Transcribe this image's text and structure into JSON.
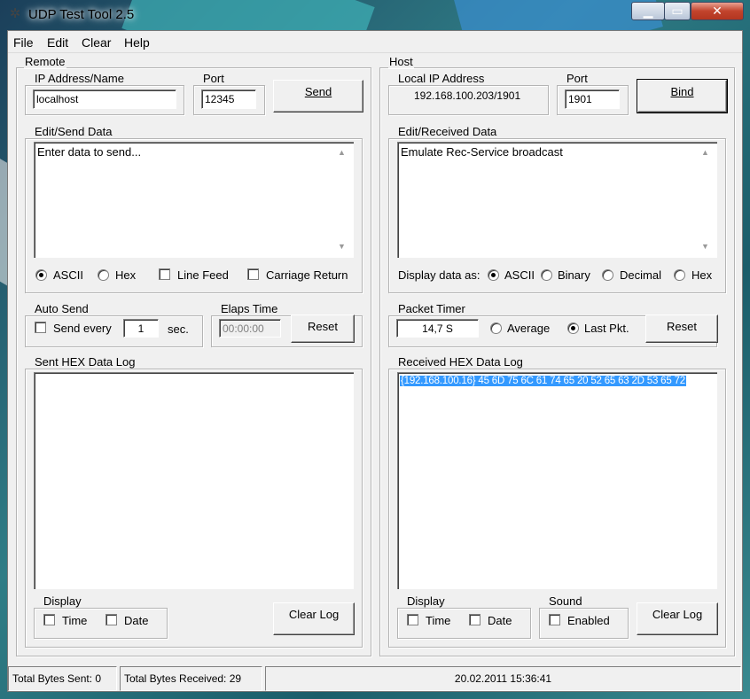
{
  "window": {
    "title": "UDP Test Tool 2.5"
  },
  "menu": [
    "File",
    "Edit",
    "Clear",
    "Help"
  ],
  "remote": {
    "group_label": "Remote",
    "ip_label": "IP Address/Name",
    "ip_value": "localhost",
    "port_label": "Port",
    "port_value": "12345",
    "send_button": "Send",
    "edit_label": "Edit/Send Data",
    "edit_text": "Enter data to send...",
    "opt_ascii": "ASCII",
    "opt_hex": "Hex",
    "opt_linefeed": "Line Feed",
    "opt_cr": "Carriage Return",
    "auto_send_label": "Auto Send",
    "send_every": "Send every",
    "send_every_value": "1",
    "sec": "sec.",
    "elaps_label": "Elaps Time",
    "elaps_value": "00:00:00",
    "reset_button": "Reset",
    "log_label": "Sent HEX Data Log",
    "display_label": "Display",
    "display_time": "Time",
    "display_date": "Date",
    "clear_log_button": "Clear Log"
  },
  "host": {
    "group_label": "Host",
    "local_ip_label": "Local IP Address",
    "local_ip_value": "192.168.100.203/1901",
    "port_label": "Port",
    "port_value": "1901",
    "bind_button": "Bind",
    "edit_label": "Edit/Received Data",
    "edit_text": "Emulate Rec-Service broadcast",
    "display_as": "Display data as:",
    "opt_ascii": "ASCII",
    "opt_binary": "Binary",
    "opt_decimal": "Decimal",
    "opt_hex": "Hex",
    "packet_label": "Packet Timer",
    "packet_value": "14,7 S",
    "opt_average": "Average",
    "opt_last": "Last Pkt.",
    "reset_button": "Reset",
    "log_label": "Received HEX Data Log",
    "log_line": "{192.168.100.16} 45 6D 75 6C 61 74 65 20 52 65 63 2D 53 65 72",
    "display_label": "Display",
    "display_time": "Time",
    "display_date": "Date",
    "sound_label": "Sound",
    "sound_enabled": "Enabled",
    "clear_log_button": "Clear Log"
  },
  "statusbar": {
    "sent": "Total Bytes Sent: 0",
    "received": "Total Bytes Received: 29",
    "datetime": "20.02.2011 15:36:41"
  }
}
